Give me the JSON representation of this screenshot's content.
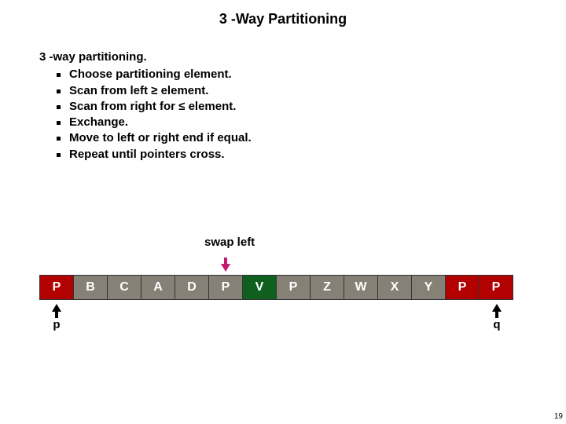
{
  "title": "3 -Way Partitioning",
  "heading": "3 -way partitioning.",
  "bullets": [
    "Choose partitioning element.",
    "Scan from left ≥ element.",
    "Scan from right for ≤  element.",
    "Exchange.",
    "Move to left or right end if equal.",
    "Repeat until pointers cross."
  ],
  "swap_label": "swap left",
  "cells": [
    "P",
    "B",
    "C",
    "A",
    "D",
    "P",
    "V",
    "P",
    "Z",
    "W",
    "X",
    "Y",
    "P",
    "P"
  ],
  "cell_colors": [
    "red",
    "gray",
    "gray",
    "gray",
    "gray",
    "gray",
    "green",
    "gray",
    "gray",
    "gray",
    "gray",
    "gray",
    "red",
    "red"
  ],
  "pointers": {
    "p": "p",
    "q": "q"
  },
  "page_number": "19"
}
